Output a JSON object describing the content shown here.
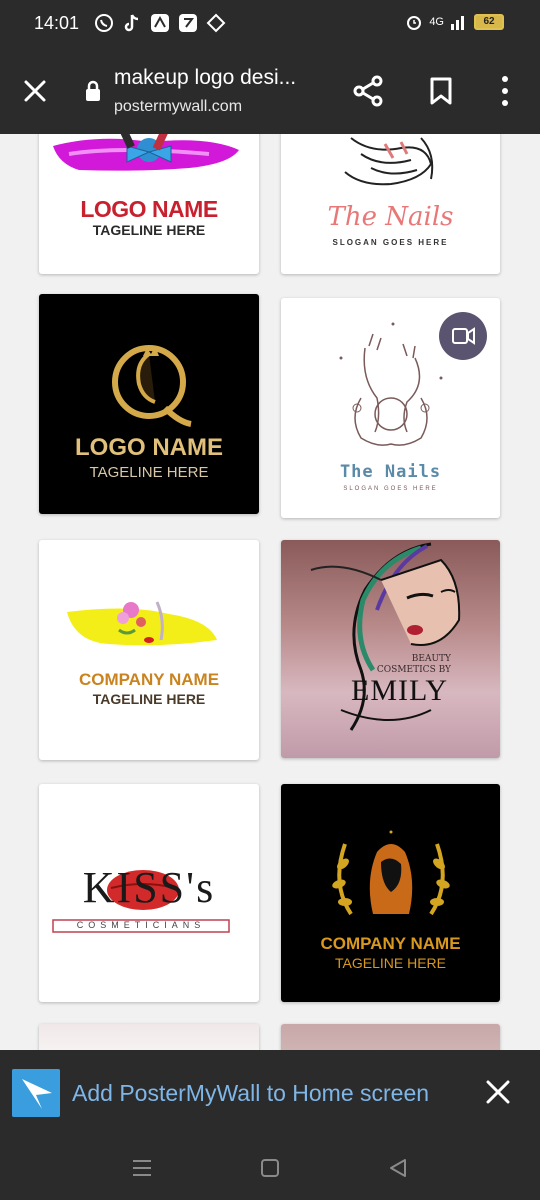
{
  "status": {
    "time": "14:01",
    "network": "4G",
    "battery": "62"
  },
  "browser": {
    "title": "makeup logo desi...",
    "url": "postermywall.com"
  },
  "cards": {
    "c1": {
      "name": "LOGO NAME",
      "tag": "TAGELINE HERE"
    },
    "c2": {
      "name": "The Nails",
      "tag": "SLOGAN GOES HERE"
    },
    "c3": {
      "name": "LOGO NAME",
      "tag": "TAGELINE HERE"
    },
    "c4": {
      "name": "The Nails",
      "tag": "SLOGAN GOES HERE"
    },
    "c5": {
      "name": "COMPANY NAME",
      "tag": "TAGELINE HERE"
    },
    "c6": {
      "line1": "BEAUTY",
      "line2": "COSMETICS BY",
      "name": "EMILY"
    },
    "c7": {
      "name": "KISS's",
      "tag": "COSMETICIANS"
    },
    "c8": {
      "name": "COMPANY NAME",
      "tag": "TAGELINE HERE"
    }
  },
  "banner": {
    "text": "Add PosterMyWall to Home screen"
  },
  "colors": {
    "bar_bg": "#2b2b2b",
    "page_bg": "#f1f1f1",
    "banner_text": "#7fb6e8",
    "gold": "#d4a94a",
    "red_logo": "#c8202e",
    "orange_company": "#c98420"
  }
}
